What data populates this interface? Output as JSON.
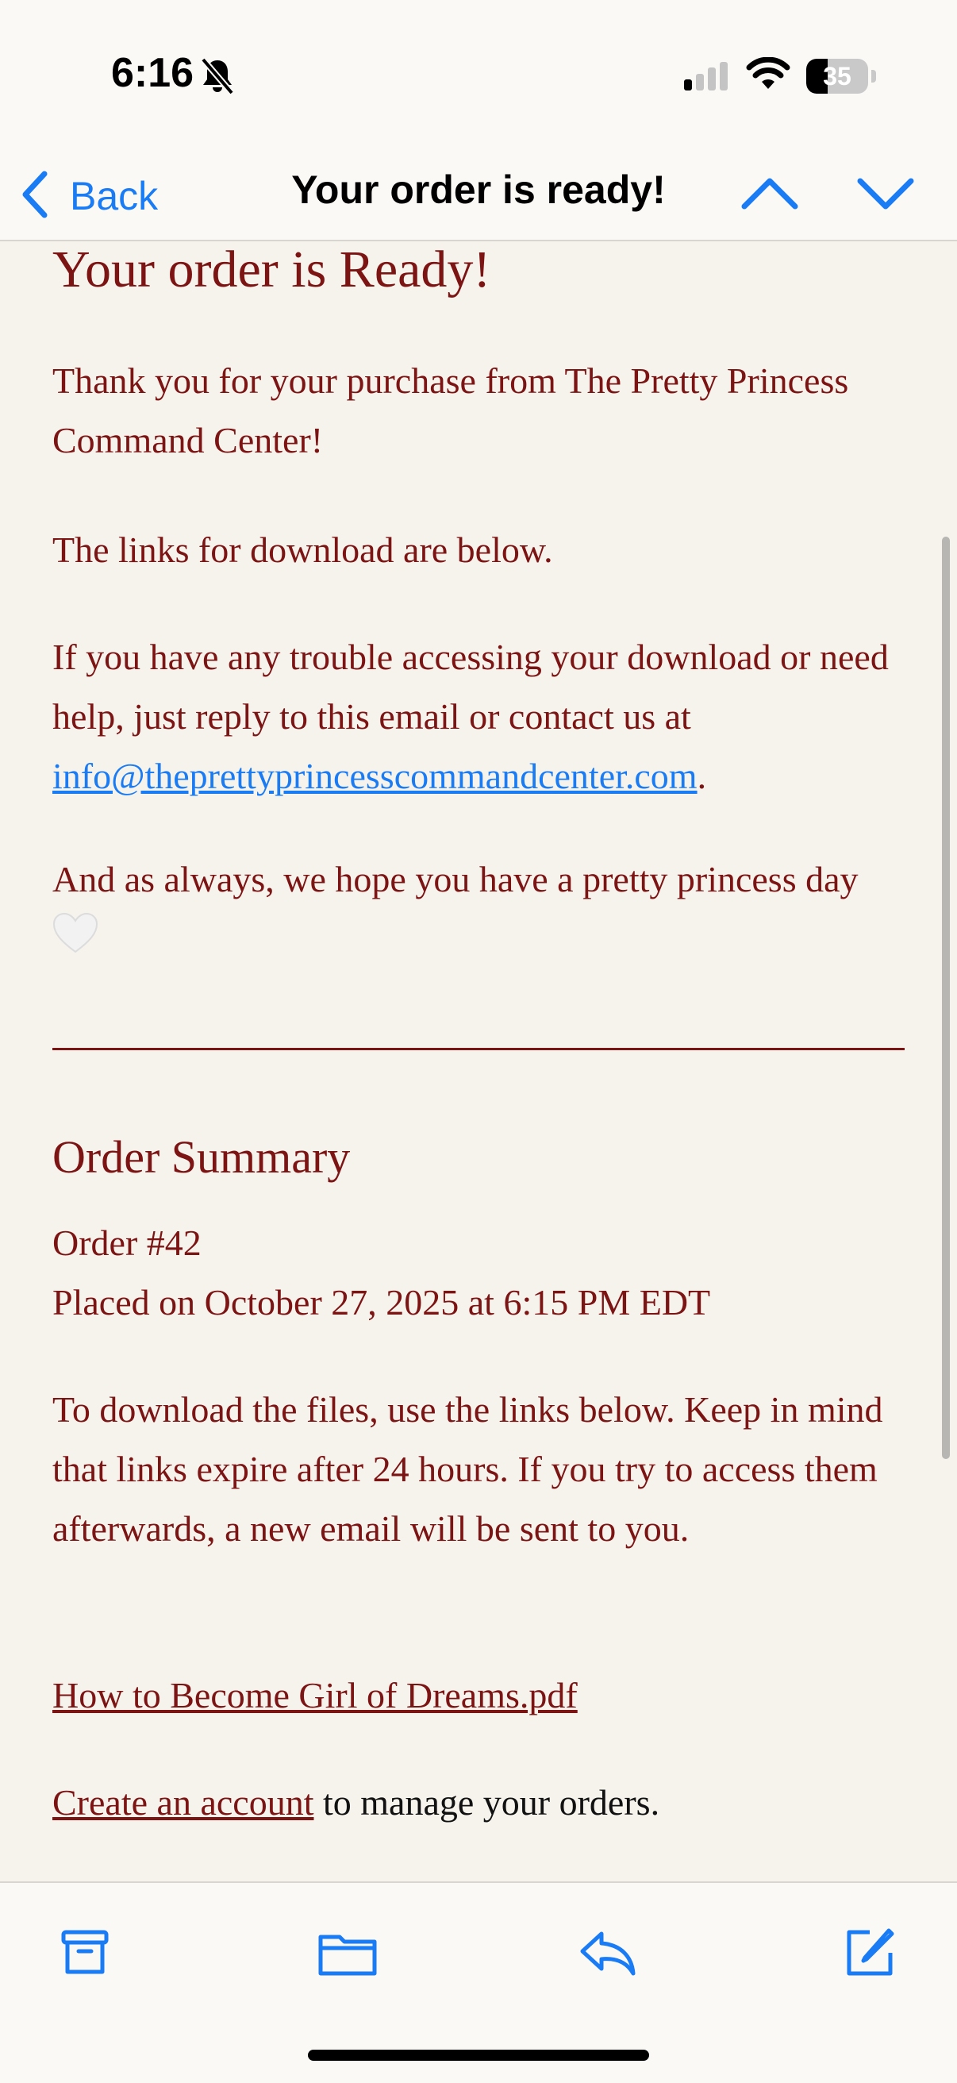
{
  "status_bar": {
    "time": "6:16",
    "battery_level": "35",
    "battery_fraction": 0.35
  },
  "nav": {
    "back_label": "Back",
    "title": "Your order is ready!"
  },
  "email": {
    "headline": "Your order is Ready!",
    "thanks": "Thank you for your purchase from The Pretty Princess Command Center!",
    "links_intro": "The links for download are below.",
    "help_text": "If you have any trouble accessing your download or need help, just reply to this email or contact us at ",
    "help_email": "info@theprettyprincesscommandcenter.com",
    "help_end": ".",
    "sign_off": "And as always, we hope you have a pretty princess day",
    "order_summary_title": "Order Summary",
    "order_number": "Order #42",
    "placed_on": "Placed on October 27, 2025 at 6:15 PM EDT",
    "download_note": "To download the files, use the links below. Keep in mind that links expire after 24 hours. If you try to access them afterwards, a new email will be sent to you.",
    "file_link": "How to Become Girl of Dreams.pdf",
    "create_account_link": "Create an account",
    "create_account_suffix": " to manage your orders."
  },
  "toolbar": {
    "icons": [
      "archive-icon",
      "folder-icon",
      "reply-icon",
      "compose-icon"
    ]
  },
  "colors": {
    "accent": "#1a7cf5",
    "email_text": "#7c1414",
    "background": "#f6f2ec"
  }
}
